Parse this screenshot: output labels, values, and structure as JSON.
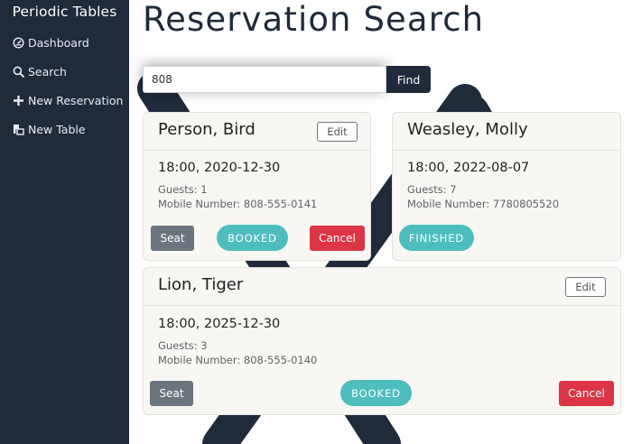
{
  "sidebar": {
    "brand": "Periodic Tables",
    "items": [
      {
        "label": "Dashboard",
        "icon": "dashboard-icon"
      },
      {
        "label": "Search",
        "icon": "search-icon"
      },
      {
        "label": "New Reservation",
        "icon": "plus-icon"
      },
      {
        "label": "New Table",
        "icon": "table-icon"
      }
    ]
  },
  "page": {
    "title": "Reservation Search"
  },
  "search": {
    "value": "808",
    "button": "Find"
  },
  "reservations": [
    {
      "name": "Person, Bird",
      "datetime": "18:00, 2020-12-30",
      "guests": "Guests: 1",
      "mobile": "Mobile Number: 808-555-0141",
      "status": "BOOKED",
      "edit": "Edit",
      "seat": "Seat",
      "cancel": "Cancel"
    },
    {
      "name": "Weasley, Molly",
      "datetime": "18:00, 2022-08-07",
      "guests": "Guests: 7",
      "mobile": "Mobile Number: 7780805520",
      "status": "FINISHED"
    },
    {
      "name": "Lion, Tiger",
      "datetime": "18:00, 2025-12-30",
      "guests": "Guests: 3",
      "mobile": "Mobile Number: 808-555-0140",
      "status": "BOOKED",
      "edit": "Edit",
      "seat": "Seat",
      "cancel": "Cancel"
    }
  ],
  "colors": {
    "sidebar": "#1f2a3a",
    "booked": "#4dbdbd",
    "cancel": "#dc3545",
    "seat": "#6c757d"
  }
}
